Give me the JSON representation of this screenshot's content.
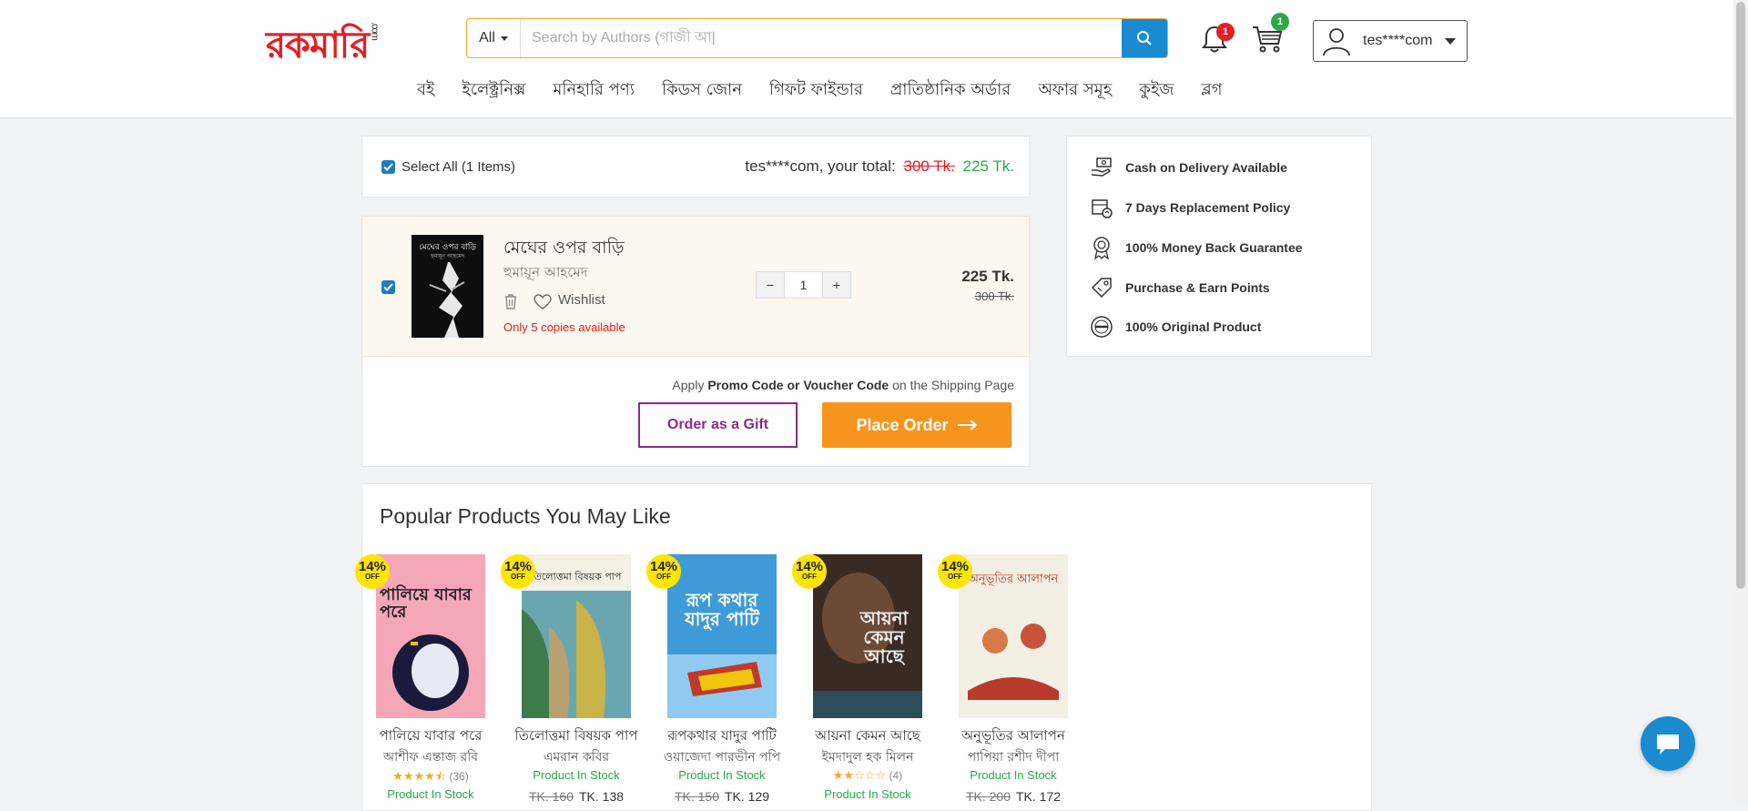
{
  "header": {
    "logo_text": "রকমারি",
    "logo_suffix": ".com",
    "search": {
      "category": "All",
      "placeholder": "Search by Authors (গাজী আ|"
    },
    "notifications_count": "1",
    "cart_count": "1",
    "user_name": "tes****com",
    "nav": [
      "বই",
      "ইলেক্ট্রনিক্স",
      "মনিহারি পণ্য",
      "কিডস জোন",
      "গিফট ফাইন্ডার",
      "প্রাতিষ্ঠানিক অর্ডার",
      "অফার সমূহ",
      "কুইজ",
      "ব্লগ"
    ]
  },
  "cart": {
    "select_all_label": "Select All (1 Items)",
    "total_prefix": "tes****com, your total:",
    "total_old": "300 Tk.",
    "total_new": "225 Tk.",
    "item": {
      "title": "মেঘের ওপর বাড়ি",
      "author": "হুমায়ূন আহমেদ",
      "wishlist_label": "Wishlist",
      "stock_note": "Only 5 copies available",
      "quantity": "1",
      "minus": "−",
      "plus": "+",
      "price": "225 Tk.",
      "old_price": "300 Tk.",
      "cover_title": "মেঘের ওপর বাড়ি",
      "cover_author": "হুমায়ূন আহমেদ"
    },
    "promo_prefix": "Apply",
    "promo_bold": "Promo Code or Voucher Code",
    "promo_suffix": "on the Shipping Page",
    "gift_button": "Order as a Gift",
    "place_order_button": "Place Order"
  },
  "features": [
    {
      "icon": "cash-hand-icon",
      "label": "Cash on Delivery Available"
    },
    {
      "icon": "replacement-box-icon",
      "label": "7 Days Replacement Policy"
    },
    {
      "icon": "money-back-badge-icon",
      "label": "100% Money Back Guarantee"
    },
    {
      "icon": "points-tag-icon",
      "label": "Purchase & Earn Points"
    },
    {
      "icon": "original-seal-icon",
      "label": "100% Original Product"
    }
  ],
  "popular": {
    "title": "Popular Products You May Like",
    "products": [
      {
        "name": "পালিয়ে যাবার পরে",
        "author": "আশীফ এন্তাজ রবি",
        "discount": "14%",
        "off": "OFF",
        "stars": "★★★★⯪",
        "rating_count": "(36)",
        "stock": "Product In Stock",
        "old_price": "",
        "price": "",
        "cover_text": "পালিয়ে যাবার পরে",
        "cover_bg": "#f5a7b8"
      },
      {
        "name": "তিলোত্তমা বিষয়ক পাপ",
        "author": "এমরান কবির",
        "discount": "14%",
        "off": "OFF",
        "stars": "",
        "rating_count": "",
        "stock": "Product In Stock",
        "old_price": "TK. 160",
        "price": "TK. 138",
        "cover_text": "তিলোত্তমা বিষয়ক পাপ",
        "cover_bg": "#6aa6b0"
      },
      {
        "name": "রূপকথার যাদুর পাটি",
        "author": "ওয়াজেদা পারভীন পপি",
        "discount": "14%",
        "off": "OFF",
        "stars": "",
        "rating_count": "",
        "stock": "Product In Stock",
        "old_price": "TK. 150",
        "price": "TK. 129",
        "cover_text": "রূপ কথার যাদুর পাটি",
        "cover_bg": "#3f9ad8"
      },
      {
        "name": "আয়না কেমন আছে",
        "author": "ইমদাদুল হক মিলন",
        "discount": "14%",
        "off": "OFF",
        "stars": "★★☆☆☆",
        "rating_count": "(4)",
        "stock": "Product In Stock",
        "old_price": "",
        "price": "",
        "cover_text": "আয়না কেমন আছে",
        "cover_bg": "#3a2a24"
      },
      {
        "name": "অনুভূতির আলাপন",
        "author": "পাপিয়া রশীদ দীপা",
        "discount": "14%",
        "off": "OFF",
        "stars": "",
        "rating_count": "",
        "stock": "Product In Stock",
        "old_price": "TK. 200",
        "price": "TK. 172",
        "cover_text": "অনুভূতির আলাপন",
        "cover_bg": "#f4efe4"
      }
    ]
  },
  "colors": {
    "accent": "#f7941d",
    "brand_red": "#e31e24",
    "link_blue": "#1a8ad1",
    "gift_purple": "#8a2a8f",
    "stock_green": "#2aa84a"
  }
}
